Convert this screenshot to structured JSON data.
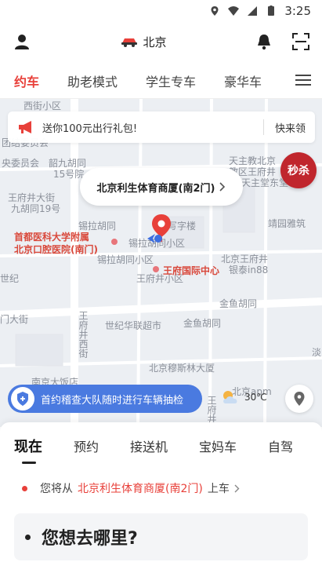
{
  "status_bar": {
    "time": "3:25"
  },
  "header": {
    "city": "北京"
  },
  "tabs": [
    {
      "label": "约车",
      "active": true
    },
    {
      "label": "助老模式",
      "active": false
    },
    {
      "label": "学生专车",
      "active": false
    },
    {
      "label": "豪华车",
      "active": false
    }
  ],
  "promo": {
    "text": "送你100元出行礼包!",
    "action": "快来领"
  },
  "seckill": {
    "label": "秒杀"
  },
  "pickup_bubble": {
    "label": "北京利生体育商厦(南2门)"
  },
  "map_labels": [
    "西街小区",
    "团结委员会",
    "央委员会",
    "韶九胡同",
    "15号院",
    "天主教北京",
    "教区王府井",
    "天主堂东堂",
    "王府井大街",
    "九胡同19号",
    "写字楼",
    "锡拉胡同",
    "锡拉胡同小区",
    "锡拉胡同小区",
    "靖园雅筑",
    "首都医科大学附属",
    "北京口腔医院(南门)",
    "王府井小区",
    "王府国际中心",
    "北京王府井",
    "银泰in88",
    "世纪",
    "金鱼胡同",
    "门大街",
    "世纪华联超市",
    "金鱼胡同",
    "王府井西街",
    "淡",
    "北京穆斯林大厦",
    "南京大饭店",
    "北京apm",
    "王府井"
  ],
  "notice": {
    "text": "首约稽查大队随时进行车辆抽检"
  },
  "weather": {
    "temp": "30℃"
  },
  "ride_tabs": [
    {
      "label": "现在",
      "active": true
    },
    {
      "label": "预约",
      "active": false
    },
    {
      "label": "接送机",
      "active": false
    },
    {
      "label": "宝妈车",
      "active": false
    },
    {
      "label": "自驾",
      "active": false
    }
  ],
  "pickup": {
    "prefix": "您将从",
    "place": "北京利生体育商厦(南2门)",
    "suffix": "上车"
  },
  "destination": {
    "placeholder": "您想去哪里?"
  },
  "colors": {
    "accent": "#e8403a",
    "seckill": "#c0262d",
    "notice": "#4a7ae0"
  }
}
